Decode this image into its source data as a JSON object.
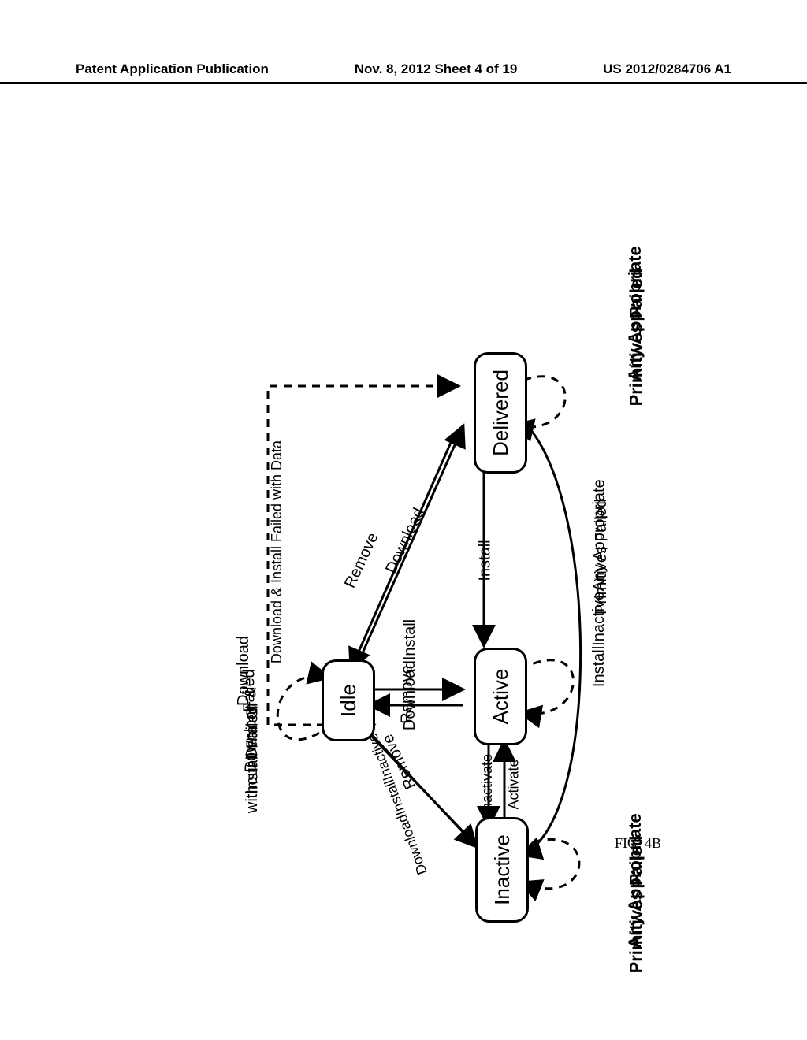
{
  "header": {
    "left": "Patent Application Publication",
    "center": "Nov. 8, 2012   Sheet 4 of 19",
    "right": "US 2012/0284706 A1"
  },
  "figure_caption": "FIG. 4B",
  "states": {
    "idle": "Idle",
    "delivered": "Delivered",
    "active": "Active",
    "inactive": "Inactive"
  },
  "transitions": {
    "download": "Download",
    "remove_delivered": "Remove",
    "download_install": "DownloadInstall",
    "remove_active": "Remove",
    "download_install_inactive": "DownloadInstallInactive",
    "remove_inactive": "Remove",
    "install": "Install",
    "inactivate": "Inactivate",
    "activate": "Activate",
    "install_inactive": "InstallInactive",
    "dl_install_failed_with_data": "Download & Install Failed with Data"
  },
  "selfloops": {
    "idle_label_line1": "Download",
    "idle_label_line2": "Failed",
    "idle_label_line3": "Or",
    "idle_label_line4": "Download &",
    "idle_label_line5": "Install Failed",
    "idle_label_line6": "without Data",
    "delivered_line1": "Any Appropriate",
    "delivered_line2": "Primitives Failed",
    "active_line1": "Any Appropriate",
    "active_line2": "Primitives Failed",
    "inactive_line1": "Any Appropriate",
    "inactive_line2": "Primitives Failed"
  }
}
